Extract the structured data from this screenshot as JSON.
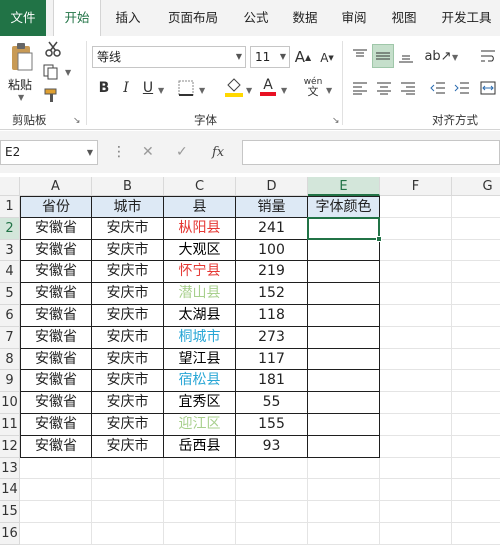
{
  "tabs": [
    "文件",
    "开始",
    "插入",
    "页面布局",
    "公式",
    "数据",
    "审阅",
    "视图",
    "开发工具"
  ],
  "active_tab": "开始",
  "ribbon": {
    "clipboard": {
      "paste_label": "粘贴",
      "group_label": "剪贴板"
    },
    "font": {
      "font_name": "等线",
      "font_size": "11",
      "group_label": "字体",
      "bold": "B",
      "italic": "I",
      "underline": "U",
      "grow": "A",
      "shrink": "A",
      "phonetic": "wén",
      "font_color_accent": "#e81123",
      "fill_color_accent": "#ffd800"
    },
    "alignment": {
      "group_label": "对齐方式"
    }
  },
  "formula_bar": {
    "name_box": "E2",
    "cancel": "✕",
    "enter": "✓",
    "fx": "fx",
    "formula": ""
  },
  "columns": [
    "A",
    "B",
    "C",
    "D",
    "E",
    "F",
    "G"
  ],
  "selected_cell": {
    "column": "E",
    "row": "2"
  },
  "rows": [
    "1",
    "2",
    "3",
    "4",
    "5",
    "6",
    "7",
    "8",
    "9",
    "10",
    "11",
    "12",
    "13",
    "14",
    "15",
    "16"
  ],
  "table": {
    "headers": [
      "省份",
      "城市",
      "县",
      "销量",
      "字体颜色"
    ],
    "data": [
      {
        "province": "安徽省",
        "city": "安庆市",
        "county": "枞阳县",
        "sales": "241",
        "font_color": "",
        "county_color": "#e53935"
      },
      {
        "province": "安徽省",
        "city": "安庆市",
        "county": "大观区",
        "sales": "100",
        "font_color": "",
        "county_color": "#000000"
      },
      {
        "province": "安徽省",
        "city": "安庆市",
        "county": "怀宁县",
        "sales": "219",
        "font_color": "",
        "county_color": "#e53935"
      },
      {
        "province": "安徽省",
        "city": "安庆市",
        "county": "潜山县",
        "sales": "152",
        "font_color": "",
        "county_color": "#a8d08d"
      },
      {
        "province": "安徽省",
        "city": "安庆市",
        "county": "太湖县",
        "sales": "118",
        "font_color": "",
        "county_color": "#000000"
      },
      {
        "province": "安徽省",
        "city": "安庆市",
        "county": "桐城市",
        "sales": "273",
        "font_color": "",
        "county_color": "#2aa7d6"
      },
      {
        "province": "安徽省",
        "city": "安庆市",
        "county": "望江县",
        "sales": "117",
        "font_color": "",
        "county_color": "#000000"
      },
      {
        "province": "安徽省",
        "city": "安庆市",
        "county": "宿松县",
        "sales": "181",
        "font_color": "",
        "county_color": "#2aa7d6"
      },
      {
        "province": "安徽省",
        "city": "安庆市",
        "county": "宜秀区",
        "sales": "55",
        "font_color": "",
        "county_color": "#000000"
      },
      {
        "province": "安徽省",
        "city": "安庆市",
        "county": "迎江区",
        "sales": "155",
        "font_color": "",
        "county_color": "#a8d08d"
      },
      {
        "province": "安徽省",
        "city": "安庆市",
        "county": "岳西县",
        "sales": "93",
        "font_color": "",
        "county_color": "#000000"
      }
    ]
  },
  "colors": {
    "accent": "#217346",
    "header_fill": "#dde9f5",
    "selection_fill": "#d3e6da"
  }
}
